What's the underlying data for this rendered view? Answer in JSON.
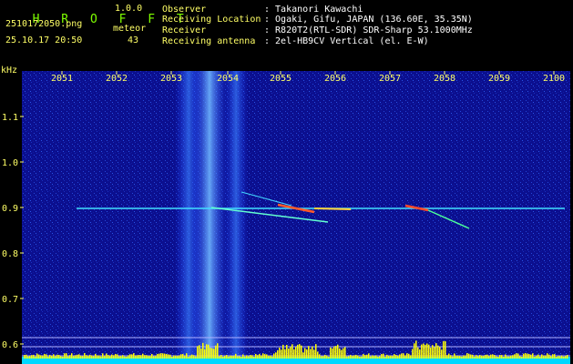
{
  "app": {
    "title": "H R O F F T",
    "version": "1.0.0"
  },
  "file": {
    "name": "2510172050.png",
    "datetime": "25.10.17 20:50"
  },
  "meteor": {
    "label": "meteor",
    "count": "43"
  },
  "info": {
    "observer_label": "Observer",
    "observer_value": ": Takanori Kawachi",
    "location_label": "Receiving Location",
    "location_value": ": Ogaki, Gifu, JAPAN (136.60E, 35.35N)",
    "receiver_label": "Receiver",
    "receiver_value": ": R820T2(RTL-SDR) SDR-Sharp 53.1000MHz",
    "antenna_label": "Receiving antenna",
    "antenna_value": ": 2el-HB9CV Vertical (el. E-W)"
  },
  "axis": {
    "unit": "kHz",
    "x_ticks": [
      "2051",
      "2052",
      "2053",
      "2054",
      "2055",
      "2056",
      "2057",
      "2058",
      "2059",
      "2100"
    ],
    "y_ticks": [
      "1.1",
      "1.0",
      "0.9",
      "0.8",
      "0.7",
      "0.6"
    ]
  },
  "colors": {
    "background": "#000000",
    "plot_bg": "#0a0a8c",
    "label_green": "#7fff00",
    "label_yellow": "#ffff66",
    "bar": "#ffff00",
    "bar_base": "#00ffff"
  }
}
